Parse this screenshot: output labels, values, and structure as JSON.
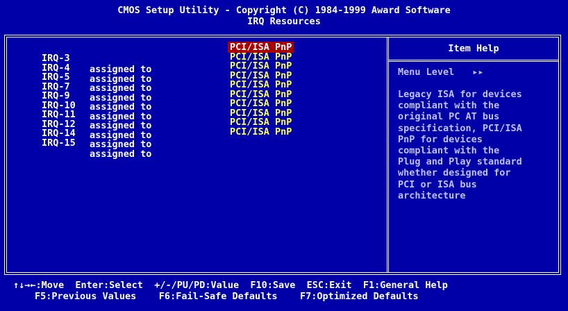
{
  "header": {
    "title": "CMOS Setup Utility - Copyright (C) 1984-1999 Award Software",
    "subtitle": "IRQ Resources"
  },
  "settings": [
    {
      "irq": "IRQ-3",
      "assigned": "assigned to",
      "value": "PCI/ISA PnP",
      "selected": true
    },
    {
      "irq": "IRQ-4",
      "assigned": "assigned to",
      "value": "PCI/ISA PnP",
      "selected": false
    },
    {
      "irq": "IRQ-5",
      "assigned": "assigned to",
      "value": "PCI/ISA PnP",
      "selected": false
    },
    {
      "irq": "IRQ-7",
      "assigned": "assigned to",
      "value": "PCI/ISA PnP",
      "selected": false
    },
    {
      "irq": "IRQ-9",
      "assigned": "assigned to",
      "value": "PCI/ISA PnP",
      "selected": false
    },
    {
      "irq": "IRQ-10",
      "assigned": "assigned to",
      "value": "PCI/ISA PnP",
      "selected": false
    },
    {
      "irq": "IRQ-11",
      "assigned": "assigned to",
      "value": "PCI/ISA PnP",
      "selected": false
    },
    {
      "irq": "IRQ-12",
      "assigned": "assigned to",
      "value": "PCI/ISA PnP",
      "selected": false
    },
    {
      "irq": "IRQ-14",
      "assigned": "assigned to",
      "value": "PCI/ISA PnP",
      "selected": false
    },
    {
      "irq": "IRQ-15",
      "assigned": "assigned to",
      "value": "PCI/ISA PnP",
      "selected": false
    }
  ],
  "help": {
    "title": "Item Help",
    "menu_level_label": "Menu Level",
    "menu_level_arrows": "▸▸",
    "text": "Legacy ISA for devices\ncompliant with the\noriginal PC AT bus\nspecification, PCI/ISA\nPnP for devices\ncompliant with the\nPlug and Play standard\nwhether designed for\nPCI or ISA bus\narchitecture"
  },
  "footer": {
    "line1": "↑↓→←:Move  Enter:Select  +/-/PU/PD:Value  F10:Save  ESC:Exit  F1:General Help",
    "line2": "F5:Previous Values    F6:Fail-Safe Defaults    F7:Optimized Defaults"
  },
  "colors": {
    "background": "#0000a8",
    "value_text": "#ffff55",
    "selected_bg": "#a80000",
    "help_text": "#c0c0ff"
  }
}
